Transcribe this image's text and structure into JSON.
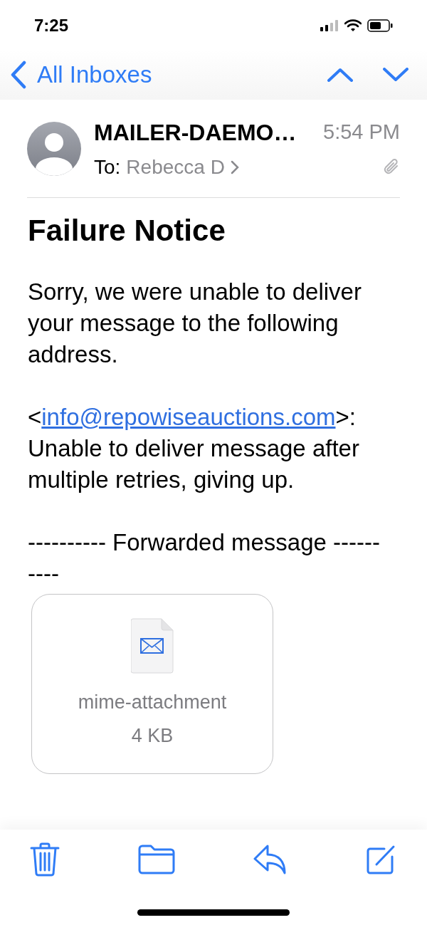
{
  "status_bar": {
    "time": "7:25"
  },
  "nav": {
    "back_label": "All Inboxes"
  },
  "message_header": {
    "sender": "MAILER-DAEMO…",
    "time": "5:54 PM",
    "to_label": "To:",
    "recipient": "Rebecca D",
    "has_attachment": true
  },
  "message": {
    "subject": "Failure Notice",
    "paragraphs": [
      {
        "kind": "text",
        "text": "Sorry, we were unable to deliver your message to the following address."
      },
      {
        "kind": "link",
        "prefix": "<",
        "link": "info@repowiseauctions.com",
        "suffix": ">: Unable to deliver message after multiple retries, giving up."
      },
      {
        "kind": "text",
        "text": "---------- Forwarded message ----------"
      }
    ],
    "attachment": {
      "name": "mime-attachment",
      "size": "4 KB"
    }
  }
}
